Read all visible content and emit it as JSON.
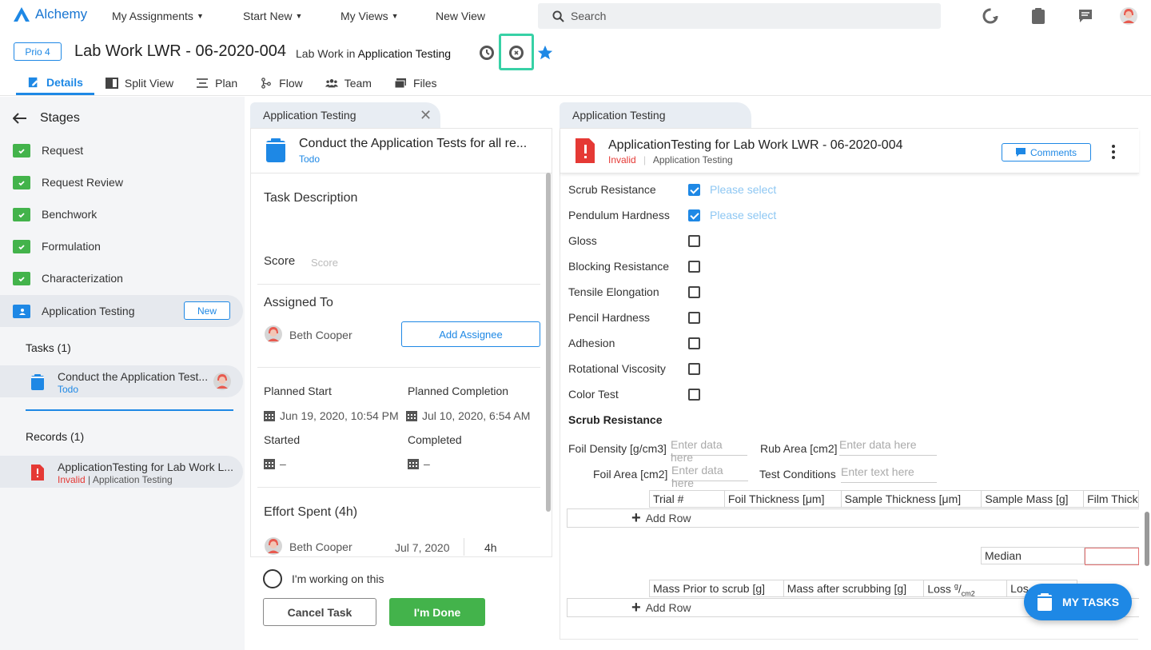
{
  "app": {
    "name": "Alchemy"
  },
  "topnav": {
    "my_assignments": "My Assignments",
    "start_new": "Start New",
    "my_views": "My Views",
    "new_view": "New View",
    "search_placeholder": "Search"
  },
  "header": {
    "prio": "Prio 4",
    "title": "Lab Work LWR - 06-2020-004",
    "subtitle_prefix": "Lab Work in",
    "subtitle_stage": "Application Testing"
  },
  "tabs": [
    {
      "label": "Details"
    },
    {
      "label": "Split View"
    },
    {
      "label": "Plan"
    },
    {
      "label": "Flow"
    },
    {
      "label": "Team"
    },
    {
      "label": "Files"
    }
  ],
  "sidebar": {
    "heading": "Stages",
    "stages": [
      {
        "label": "Request"
      },
      {
        "label": "Request Review"
      },
      {
        "label": "Benchwork"
      },
      {
        "label": "Formulation"
      },
      {
        "label": "Characterization"
      },
      {
        "label": "Application Testing",
        "badge": "New"
      }
    ],
    "tasks_heading": "Tasks (1)",
    "task_item": {
      "title": "Conduct the Application Test...",
      "status": "Todo"
    },
    "records_heading": "Records (1)",
    "record_item": {
      "title": "ApplicationTesting for Lab Work L...",
      "status": "Invalid",
      "sep": "|",
      "stage": "Application Testing"
    }
  },
  "task_panel": {
    "tab": "Application Testing",
    "title": "Conduct the Application Tests for all re...",
    "status": "Todo",
    "task_description": "Task Description",
    "score_label": "Score",
    "score_placeholder": "Score",
    "assigned_to": "Assigned To",
    "assignee": "Beth Cooper",
    "add_assignee": "Add Assignee",
    "planned_start_label": "Planned Start",
    "planned_start": "Jun 19, 2020, 10:54 PM",
    "planned_completion_label": "Planned Completion",
    "planned_completion": "Jul 10, 2020, 6:54 AM",
    "started_label": "Started",
    "started": "–",
    "completed_label": "Completed",
    "completed": "–",
    "effort_label": "Effort Spent (4h)",
    "effort_person": "Beth Cooper",
    "effort_date": "Jul 7, 2020",
    "effort_hours": "4h",
    "working_on": "I'm working on this",
    "cancel": "Cancel Task",
    "done": "I'm Done"
  },
  "record_panel": {
    "tab": "Application Testing",
    "title": "ApplicationTesting for Lab Work LWR - 06-2020-004",
    "status": "Invalid",
    "stage": "Application Testing",
    "comments": "Comments",
    "checklist": [
      {
        "label": "Scrub Resistance",
        "checked": true,
        "hint": "Please select"
      },
      {
        "label": "Pendulum Hardness",
        "checked": true,
        "hint": "Please select"
      },
      {
        "label": "Gloss",
        "checked": false
      },
      {
        "label": "Blocking Resistance",
        "checked": false
      },
      {
        "label": "Tensile Elongation",
        "checked": false
      },
      {
        "label": "Pencil Hardness",
        "checked": false
      },
      {
        "label": "Adhesion",
        "checked": false
      },
      {
        "label": "Rotational Viscosity",
        "checked": false
      },
      {
        "label": "Color Test",
        "checked": false
      }
    ],
    "section_title": "Scrub Resistance",
    "foil_density_label": "Foil Density [g/cm3]",
    "foil_density_ph": "Enter data here",
    "rub_area_label": "Rub Area [cm2]",
    "rub_area_ph": "Enter data here",
    "foil_area_label": "Foil Area [cm2]",
    "foil_area_ph": "Enter data here",
    "test_conditions_label": "Test Conditions",
    "test_conditions_ph": "Enter text here",
    "table1_headers": [
      "Trial #",
      "Foil Thickness [μm]",
      "Sample Thickness [μm]",
      "Sample Mass [g]",
      "Film Thick"
    ],
    "add_row": "Add Row",
    "median_label": "Median",
    "table2_headers": [
      "Mass Prior to scrub [g]",
      "Mass after scrubbing [g]",
      "Loss",
      "Los"
    ],
    "loss_unit_num": "g",
    "loss_unit_den": "cm2"
  },
  "fab": {
    "label": "MY TASKS"
  },
  "colors": {
    "accent": "#1e88e5",
    "success": "#43b34b",
    "error": "#e53935",
    "highlight": "#37d1a6"
  }
}
